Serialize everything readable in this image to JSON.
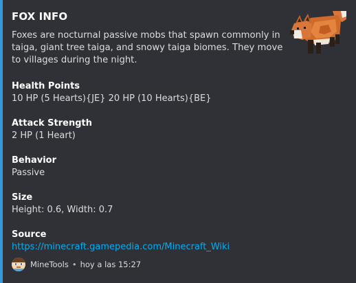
{
  "embed": {
    "accent_color": "#3498db",
    "title": "FOX INFO",
    "description": "Foxes are nocturnal passive mobs that spawn commonly in taiga, giant tree taiga, and snowy taiga biomes. They move to villages during the night.",
    "thumbnail_icon": "fox-icon",
    "fields": [
      {
        "name": "Health Points",
        "value": "10 HP (5 Hearts){JE} 20 HP (10 Hearts){BE}"
      },
      {
        "name": "Attack Strength",
        "value": "2 HP (1 Heart)"
      },
      {
        "name": "Behavior",
        "value": "Passive"
      },
      {
        "name": "Size",
        "value": "Height: 0.6, Width: 0.7"
      },
      {
        "name": "Source",
        "value": "https://minecraft.gamepedia.com/Minecraft_Wiki"
      }
    ],
    "footer": {
      "author": "MineTools",
      "separator": "•",
      "timestamp": "hoy a las 15:27",
      "avatar_icon": "minetools-avatar-icon"
    }
  }
}
